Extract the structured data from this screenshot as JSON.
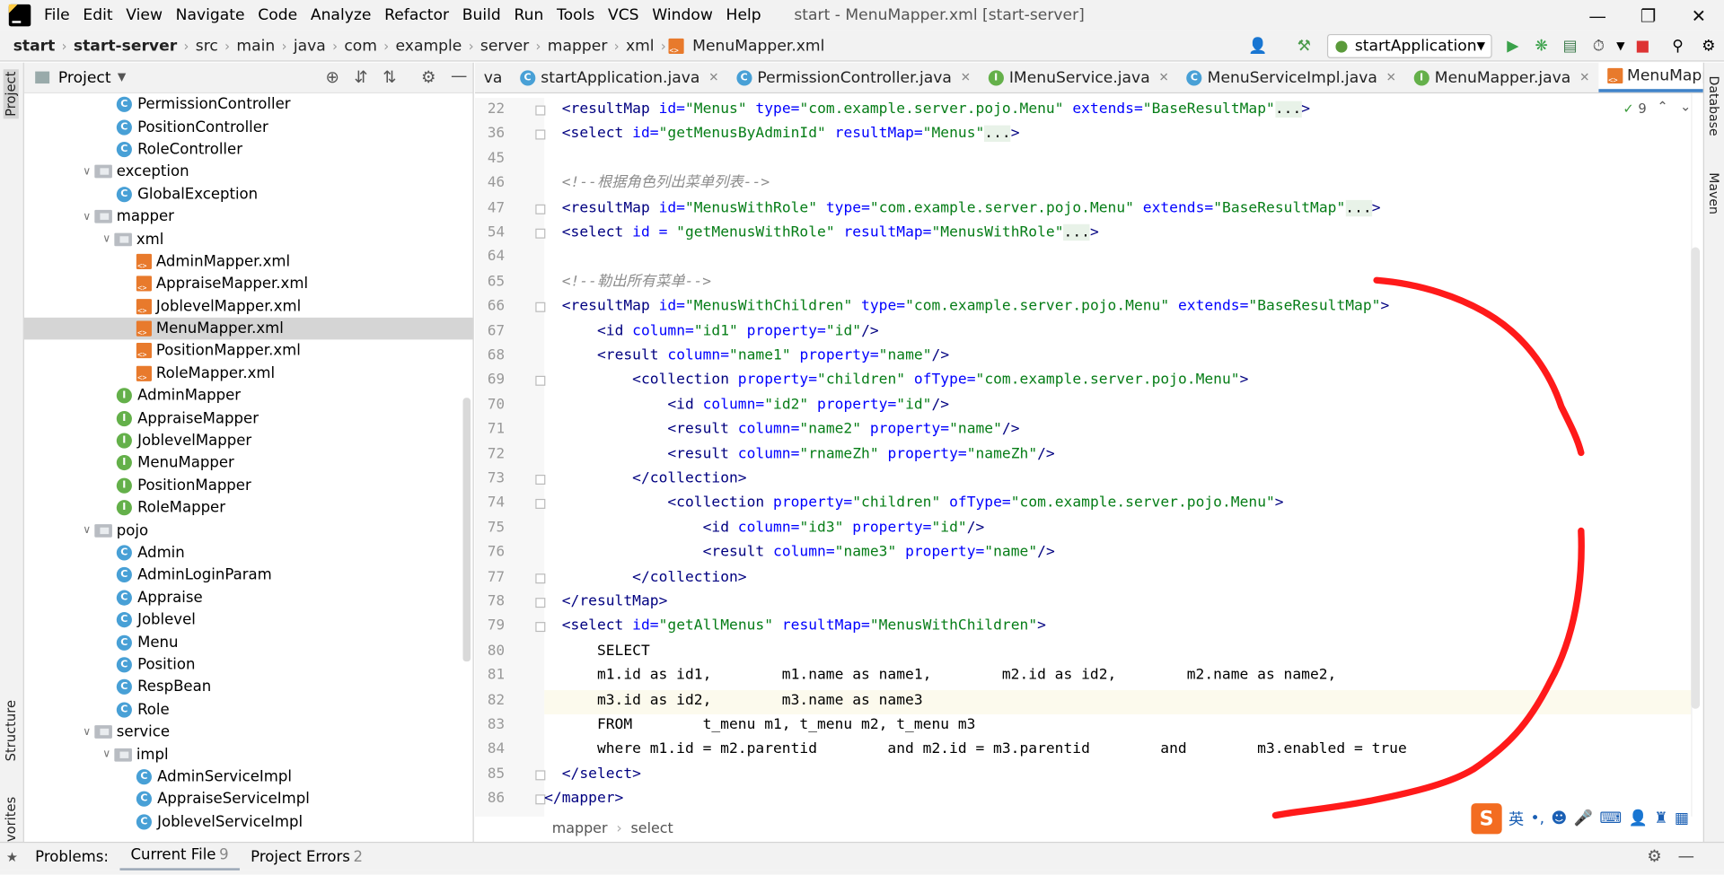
{
  "menubar": {
    "items": [
      "File",
      "Edit",
      "View",
      "Navigate",
      "Code",
      "Analyze",
      "Refactor",
      "Build",
      "Run",
      "Tools",
      "VCS",
      "Window",
      "Help"
    ],
    "window_title": "start - MenuMapper.xml [start-server]"
  },
  "navbar": {
    "breadcrumbs": [
      "start",
      "start-server",
      "src",
      "main",
      "java",
      "com",
      "example",
      "server",
      "mapper",
      "xml",
      "MenuMapper.xml"
    ],
    "run_config": "startApplication"
  },
  "project_panel": {
    "title": "Project",
    "tree": [
      {
        "label": "PermissionController",
        "indent": 3,
        "icon": "class"
      },
      {
        "label": "PositionController",
        "indent": 3,
        "icon": "class"
      },
      {
        "label": "RoleController",
        "indent": 3,
        "icon": "class"
      },
      {
        "label": "exception",
        "indent": 2,
        "icon": "folder",
        "arrow": "open"
      },
      {
        "label": "GlobalException",
        "indent": 3,
        "icon": "class"
      },
      {
        "label": "mapper",
        "indent": 2,
        "icon": "folder",
        "arrow": "open"
      },
      {
        "label": "xml",
        "indent": 3,
        "icon": "folder",
        "arrow": "open"
      },
      {
        "label": "AdminMapper.xml",
        "indent": 4,
        "icon": "xml"
      },
      {
        "label": "AppraiseMapper.xml",
        "indent": 4,
        "icon": "xml"
      },
      {
        "label": "JoblevelMapper.xml",
        "indent": 4,
        "icon": "xml"
      },
      {
        "label": "MenuMapper.xml",
        "indent": 4,
        "icon": "xml",
        "selected": true
      },
      {
        "label": "PositionMapper.xml",
        "indent": 4,
        "icon": "xml"
      },
      {
        "label": "RoleMapper.xml",
        "indent": 4,
        "icon": "xml"
      },
      {
        "label": "AdminMapper",
        "indent": 3,
        "icon": "interface"
      },
      {
        "label": "AppraiseMapper",
        "indent": 3,
        "icon": "interface"
      },
      {
        "label": "JoblevelMapper",
        "indent": 3,
        "icon": "interface"
      },
      {
        "label": "MenuMapper",
        "indent": 3,
        "icon": "interface"
      },
      {
        "label": "PositionMapper",
        "indent": 3,
        "icon": "interface"
      },
      {
        "label": "RoleMapper",
        "indent": 3,
        "icon": "interface"
      },
      {
        "label": "pojo",
        "indent": 2,
        "icon": "folder",
        "arrow": "open"
      },
      {
        "label": "Admin",
        "indent": 3,
        "icon": "class"
      },
      {
        "label": "AdminLoginParam",
        "indent": 3,
        "icon": "class"
      },
      {
        "label": "Appraise",
        "indent": 3,
        "icon": "class"
      },
      {
        "label": "Joblevel",
        "indent": 3,
        "icon": "class"
      },
      {
        "label": "Menu",
        "indent": 3,
        "icon": "class"
      },
      {
        "label": "Position",
        "indent": 3,
        "icon": "class"
      },
      {
        "label": "RespBean",
        "indent": 3,
        "icon": "class"
      },
      {
        "label": "Role",
        "indent": 3,
        "icon": "class"
      },
      {
        "label": "service",
        "indent": 2,
        "icon": "folder",
        "arrow": "open"
      },
      {
        "label": "impl",
        "indent": 3,
        "icon": "folder",
        "arrow": "open"
      },
      {
        "label": "AdminServiceImpl",
        "indent": 4,
        "icon": "class"
      },
      {
        "label": "AppraiseServiceImpl",
        "indent": 4,
        "icon": "class"
      },
      {
        "label": "JoblevelServiceImpl",
        "indent": 4,
        "icon": "class"
      }
    ]
  },
  "tabs": [
    {
      "label": "va",
      "icon": "none"
    },
    {
      "label": "startApplication.java",
      "icon": "class-run"
    },
    {
      "label": "PermissionController.java",
      "icon": "class"
    },
    {
      "label": "IMenuService.java",
      "icon": "interface"
    },
    {
      "label": "MenuServiceImpl.java",
      "icon": "class"
    },
    {
      "label": "MenuMapper.java",
      "icon": "interface"
    },
    {
      "label": "MenuMapper.xml",
      "icon": "xml",
      "active": true
    }
  ],
  "editor": {
    "problems_badge": "9",
    "lines": [
      {
        "n": "22",
        "tokens": [
          [
            "  ",
            ""
          ],
          [
            "<resultMap ",
            "tag"
          ],
          [
            "id=",
            "attr"
          ],
          [
            "\"Menus\"",
            "str"
          ],
          [
            " type=",
            "attr"
          ],
          [
            "\"com.example.server.pojo.Menu\"",
            "str"
          ],
          [
            " extends=",
            "attr"
          ],
          [
            "\"BaseResultMap\"",
            "str"
          ],
          [
            "...",
            "dots"
          ],
          [
            ">",
            "tag"
          ]
        ]
      },
      {
        "n": "36",
        "tokens": [
          [
            "  ",
            ""
          ],
          [
            "<select ",
            "tag"
          ],
          [
            "id=",
            "attr"
          ],
          [
            "\"getMenusByAdminId\"",
            "str"
          ],
          [
            " resultMap=",
            "attr"
          ],
          [
            "\"Menus\"",
            "str"
          ],
          [
            "...",
            "dots"
          ],
          [
            ">",
            "tag"
          ]
        ]
      },
      {
        "n": "45",
        "tokens": []
      },
      {
        "n": "46",
        "tokens": [
          [
            "  ",
            ""
          ],
          [
            "<!--根据角色列出菜单列表-->",
            "cmt"
          ]
        ]
      },
      {
        "n": "47",
        "tokens": [
          [
            "  ",
            ""
          ],
          [
            "<resultMap ",
            "tag"
          ],
          [
            "id=",
            "attr"
          ],
          [
            "\"MenusWithRole\"",
            "str"
          ],
          [
            " type=",
            "attr"
          ],
          [
            "\"com.example.server.pojo.Menu\"",
            "str"
          ],
          [
            " extends=",
            "attr"
          ],
          [
            "\"BaseResultMap\"",
            "str"
          ],
          [
            "...",
            "dots"
          ],
          [
            ">",
            "tag"
          ]
        ]
      },
      {
        "n": "54",
        "tokens": [
          [
            "  ",
            ""
          ],
          [
            "<select ",
            "tag"
          ],
          [
            "id = ",
            "attr"
          ],
          [
            "\"getMenusWithRole\"",
            "str"
          ],
          [
            " resultMap=",
            "attr"
          ],
          [
            "\"MenusWithRole\"",
            "str"
          ],
          [
            "...",
            "dots"
          ],
          [
            ">",
            "tag"
          ]
        ]
      },
      {
        "n": "64",
        "tokens": []
      },
      {
        "n": "65",
        "tokens": [
          [
            "  ",
            ""
          ],
          [
            "<!--勒出所有菜单-->",
            "cmt"
          ]
        ]
      },
      {
        "n": "66",
        "tokens": [
          [
            "  ",
            ""
          ],
          [
            "<resultMap ",
            "tag"
          ],
          [
            "id=",
            "attr"
          ],
          [
            "\"MenusWithChildren\"",
            "str"
          ],
          [
            " type=",
            "attr"
          ],
          [
            "\"com.example.server.pojo.Menu\"",
            "str"
          ],
          [
            " extends=",
            "attr"
          ],
          [
            "\"BaseResultMap\"",
            "str"
          ],
          [
            ">",
            "tag"
          ]
        ]
      },
      {
        "n": "67",
        "tokens": [
          [
            "      ",
            ""
          ],
          [
            "<id ",
            "tag"
          ],
          [
            "column=",
            "attr"
          ],
          [
            "\"id1\"",
            "str"
          ],
          [
            " property=",
            "attr"
          ],
          [
            "\"id\"",
            "str"
          ],
          [
            "/>",
            "tag"
          ]
        ]
      },
      {
        "n": "68",
        "tokens": [
          [
            "      ",
            ""
          ],
          [
            "<result ",
            "tag"
          ],
          [
            "column=",
            "attr"
          ],
          [
            "\"name1\"",
            "str"
          ],
          [
            " property=",
            "attr"
          ],
          [
            "\"name\"",
            "str"
          ],
          [
            "/>",
            "tag"
          ]
        ]
      },
      {
        "n": "69",
        "tokens": [
          [
            "          ",
            ""
          ],
          [
            "<collection ",
            "tag"
          ],
          [
            "property=",
            "attr"
          ],
          [
            "\"children\"",
            "str"
          ],
          [
            " ofType=",
            "attr"
          ],
          [
            "\"com.example.server.pojo.Menu\"",
            "str"
          ],
          [
            ">",
            "tag"
          ]
        ]
      },
      {
        "n": "70",
        "tokens": [
          [
            "              ",
            ""
          ],
          [
            "<id ",
            "tag"
          ],
          [
            "column=",
            "attr"
          ],
          [
            "\"id2\"",
            "str"
          ],
          [
            " property=",
            "attr"
          ],
          [
            "\"id\"",
            "str"
          ],
          [
            "/>",
            "tag"
          ]
        ]
      },
      {
        "n": "71",
        "tokens": [
          [
            "              ",
            ""
          ],
          [
            "<result ",
            "tag"
          ],
          [
            "column=",
            "attr"
          ],
          [
            "\"name2\"",
            "str"
          ],
          [
            " property=",
            "attr"
          ],
          [
            "\"name\"",
            "str"
          ],
          [
            "/>",
            "tag"
          ]
        ]
      },
      {
        "n": "72",
        "tokens": [
          [
            "              ",
            ""
          ],
          [
            "<result ",
            "tag"
          ],
          [
            "column=",
            "attr"
          ],
          [
            "\"rnameZh\"",
            "str"
          ],
          [
            " property=",
            "attr"
          ],
          [
            "\"nameZh\"",
            "str"
          ],
          [
            "/>",
            "tag"
          ]
        ]
      },
      {
        "n": "73",
        "tokens": [
          [
            "          ",
            ""
          ],
          [
            "</collection>",
            "tag"
          ]
        ]
      },
      {
        "n": "74",
        "tokens": [
          [
            "              ",
            ""
          ],
          [
            "<collection ",
            "tag"
          ],
          [
            "property=",
            "attr"
          ],
          [
            "\"children\"",
            "str"
          ],
          [
            " ofType=",
            "attr"
          ],
          [
            "\"com.example.server.pojo.Menu\"",
            "str"
          ],
          [
            ">",
            "tag"
          ]
        ]
      },
      {
        "n": "75",
        "tokens": [
          [
            "                  ",
            ""
          ],
          [
            "<id ",
            "tag"
          ],
          [
            "column=",
            "attr"
          ],
          [
            "\"id3\"",
            "str"
          ],
          [
            " property=",
            "attr"
          ],
          [
            "\"id\"",
            "str"
          ],
          [
            "/>",
            "tag"
          ]
        ]
      },
      {
        "n": "76",
        "tokens": [
          [
            "                  ",
            ""
          ],
          [
            "<result ",
            "tag"
          ],
          [
            "column=",
            "attr"
          ],
          [
            "\"name3\"",
            "str"
          ],
          [
            " property=",
            "attr"
          ],
          [
            "\"name\"",
            "str"
          ],
          [
            "/>",
            "tag"
          ]
        ]
      },
      {
        "n": "77",
        "tokens": [
          [
            "          ",
            ""
          ],
          [
            "</collection>",
            "tag"
          ]
        ]
      },
      {
        "n": "78",
        "tokens": [
          [
            "  ",
            ""
          ],
          [
            "</resultMap>",
            "tag"
          ]
        ]
      },
      {
        "n": "79",
        "tokens": [
          [
            "  ",
            ""
          ],
          [
            "<select ",
            "tag"
          ],
          [
            "id=",
            "attr"
          ],
          [
            "\"getAllMenus\"",
            "str"
          ],
          [
            " resultMap=",
            "attr"
          ],
          [
            "\"MenusWithChildren\"",
            "str"
          ],
          [
            ">",
            "tag"
          ]
        ]
      },
      {
        "n": "80",
        "tokens": [
          [
            "      SELECT",
            ""
          ]
        ]
      },
      {
        "n": "81",
        "tokens": [
          [
            "      m1.id as id1,        m1.name as name1,        m2.id as id2,        m2.name as name2,",
            ""
          ]
        ]
      },
      {
        "n": "82",
        "tokens": [
          [
            "      m3.id as id2,        m3.name as name3",
            ""
          ]
        ]
      },
      {
        "n": "83",
        "tokens": [
          [
            "      FROM        t_menu m1, t_menu m2, t_menu m3",
            ""
          ]
        ]
      },
      {
        "n": "84",
        "tokens": [
          [
            "      where m1.id = m2.parentid        and m2.id = m3.parentid        and        m3.enabled = true",
            ""
          ]
        ]
      },
      {
        "n": "85",
        "tokens": [
          [
            "  ",
            ""
          ],
          [
            "</select>",
            "tag"
          ]
        ]
      },
      {
        "n": "86",
        "tokens": [
          [
            "",
            ""
          ],
          [
            "</mapper>",
            "tag"
          ]
        ]
      }
    ]
  },
  "breadcrumb": [
    "mapper",
    "select"
  ],
  "problems": {
    "tabs": [
      {
        "label": "Problems:",
        "count": ""
      },
      {
        "label": "Current File",
        "count": "9",
        "active": true
      },
      {
        "label": "Project Errors",
        "count": "2"
      }
    ]
  },
  "left_strip": [
    "Project",
    "Structure",
    "Favorites"
  ],
  "right_strip": [
    "Database",
    "Maven"
  ],
  "ime": {
    "label": "英"
  },
  "colors": {
    "accent": "#4083c9",
    "annotation": "#ff0000"
  }
}
